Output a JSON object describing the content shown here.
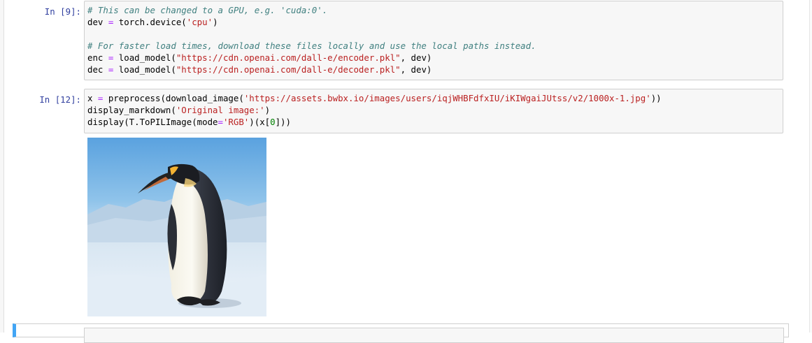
{
  "cells": [
    {
      "prompt": "In [9]:",
      "lines": [
        [
          {
            "t": "# This can be changed to a GPU, e.g. 'cuda:0'.",
            "c": "cm-comment"
          }
        ],
        [
          {
            "t": "dev ",
            "c": ""
          },
          {
            "t": "=",
            "c": "cm-op"
          },
          {
            "t": " torch.device(",
            "c": ""
          },
          {
            "t": "'cpu'",
            "c": "cm-string"
          },
          {
            "t": ")",
            "c": ""
          }
        ],
        [],
        [
          {
            "t": "# For faster load times, download these files locally and use the local paths instead.",
            "c": "cm-comment"
          }
        ],
        [
          {
            "t": "enc ",
            "c": ""
          },
          {
            "t": "=",
            "c": "cm-op"
          },
          {
            "t": " load_model(",
            "c": ""
          },
          {
            "t": "\"https://cdn.openai.com/dall-e/encoder.pkl\"",
            "c": "cm-string"
          },
          {
            "t": ", dev)",
            "c": ""
          }
        ],
        [
          {
            "t": "dec ",
            "c": ""
          },
          {
            "t": "=",
            "c": "cm-op"
          },
          {
            "t": " load_model(",
            "c": ""
          },
          {
            "t": "\"https://cdn.openai.com/dall-e/decoder.pkl\"",
            "c": "cm-string"
          },
          {
            "t": ", dev)",
            "c": ""
          }
        ]
      ]
    },
    {
      "prompt": "In [12]:",
      "lines": [
        [
          {
            "t": "x ",
            "c": ""
          },
          {
            "t": "=",
            "c": "cm-op"
          },
          {
            "t": " preprocess(download_image(",
            "c": ""
          },
          {
            "t": "'https://assets.bwbx.io/images/users/iqjWHBFdfxIU/iKIWgaiJUtss/v2/1000x-1.jpg'",
            "c": "cm-string"
          },
          {
            "t": "))",
            "c": ""
          }
        ],
        [
          {
            "t": "display_markdown(",
            "c": ""
          },
          {
            "t": "'Original image:'",
            "c": "cm-string"
          },
          {
            "t": ")",
            "c": ""
          }
        ],
        [
          {
            "t": "display(T.ToPILImage(mode",
            "c": ""
          },
          {
            "t": "=",
            "c": "cm-op"
          },
          {
            "t": "'RGB'",
            "c": "cm-string"
          },
          {
            "t": ")(x[",
            "c": ""
          },
          {
            "t": "0",
            "c": "cm-num"
          },
          {
            "t": "]))",
            "c": ""
          }
        ]
      ]
    }
  ],
  "output": {
    "image_icon": "penguin-photo"
  }
}
